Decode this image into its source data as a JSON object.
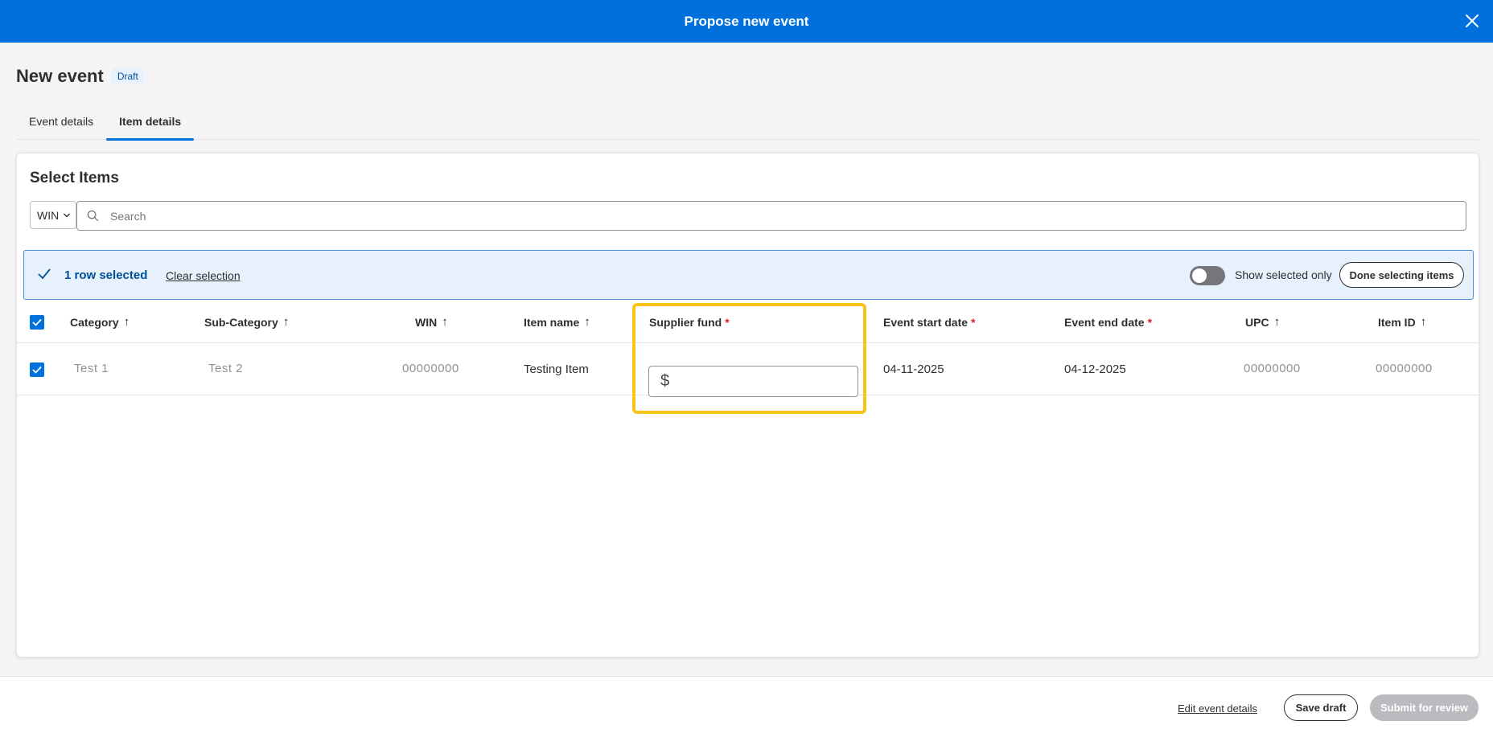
{
  "header": {
    "title": "Propose new event",
    "close_icon": "close-icon"
  },
  "page": {
    "title": "New event",
    "status_badge": "Draft"
  },
  "tabs": [
    {
      "label": "Event details",
      "active": false
    },
    {
      "label": "Item details",
      "active": true
    }
  ],
  "select_items": {
    "title": "Select Items",
    "search_type": "WIN",
    "search_placeholder": "Search"
  },
  "selection_bar": {
    "count_text": "1 row selected",
    "clear_label": "Clear selection",
    "toggle_label": "Show selected only",
    "toggle_on": false,
    "done_label": "Done selecting items"
  },
  "table": {
    "columns": [
      {
        "label": "Category",
        "sortable": true,
        "required": false
      },
      {
        "label": "Sub-Category",
        "sortable": true,
        "required": false
      },
      {
        "label": "WIN",
        "sortable": true,
        "required": false
      },
      {
        "label": "Item name",
        "sortable": true,
        "required": false
      },
      {
        "label": "Supplier fund",
        "sortable": false,
        "required": true
      },
      {
        "label": "Event start date",
        "sortable": false,
        "required": true
      },
      {
        "label": "Event end date",
        "sortable": false,
        "required": true
      },
      {
        "label": "UPC",
        "sortable": true,
        "required": false
      },
      {
        "label": "Item ID",
        "sortable": true,
        "required": false
      }
    ],
    "sort_arrow": "↑",
    "required_mark": "*",
    "rows": [
      {
        "selected": true,
        "category": "Test 1",
        "sub_category": "Test 2",
        "win": "00000000",
        "item_name": "Testing Item",
        "supplier_fund_prefix": "$",
        "supplier_fund_value": "",
        "event_start_date": "04-11-2025",
        "event_end_date": "04-12-2025",
        "upc": "00000000",
        "item_id": "00000000"
      }
    ]
  },
  "footer": {
    "edit_label": "Edit event details",
    "save_label": "Save draft",
    "submit_label": "Submit for review"
  },
  "colors": {
    "brand_blue": "#0071dc",
    "highlight": "#f8c31a",
    "required": "#de1c24",
    "disabled": "#babbbe"
  }
}
